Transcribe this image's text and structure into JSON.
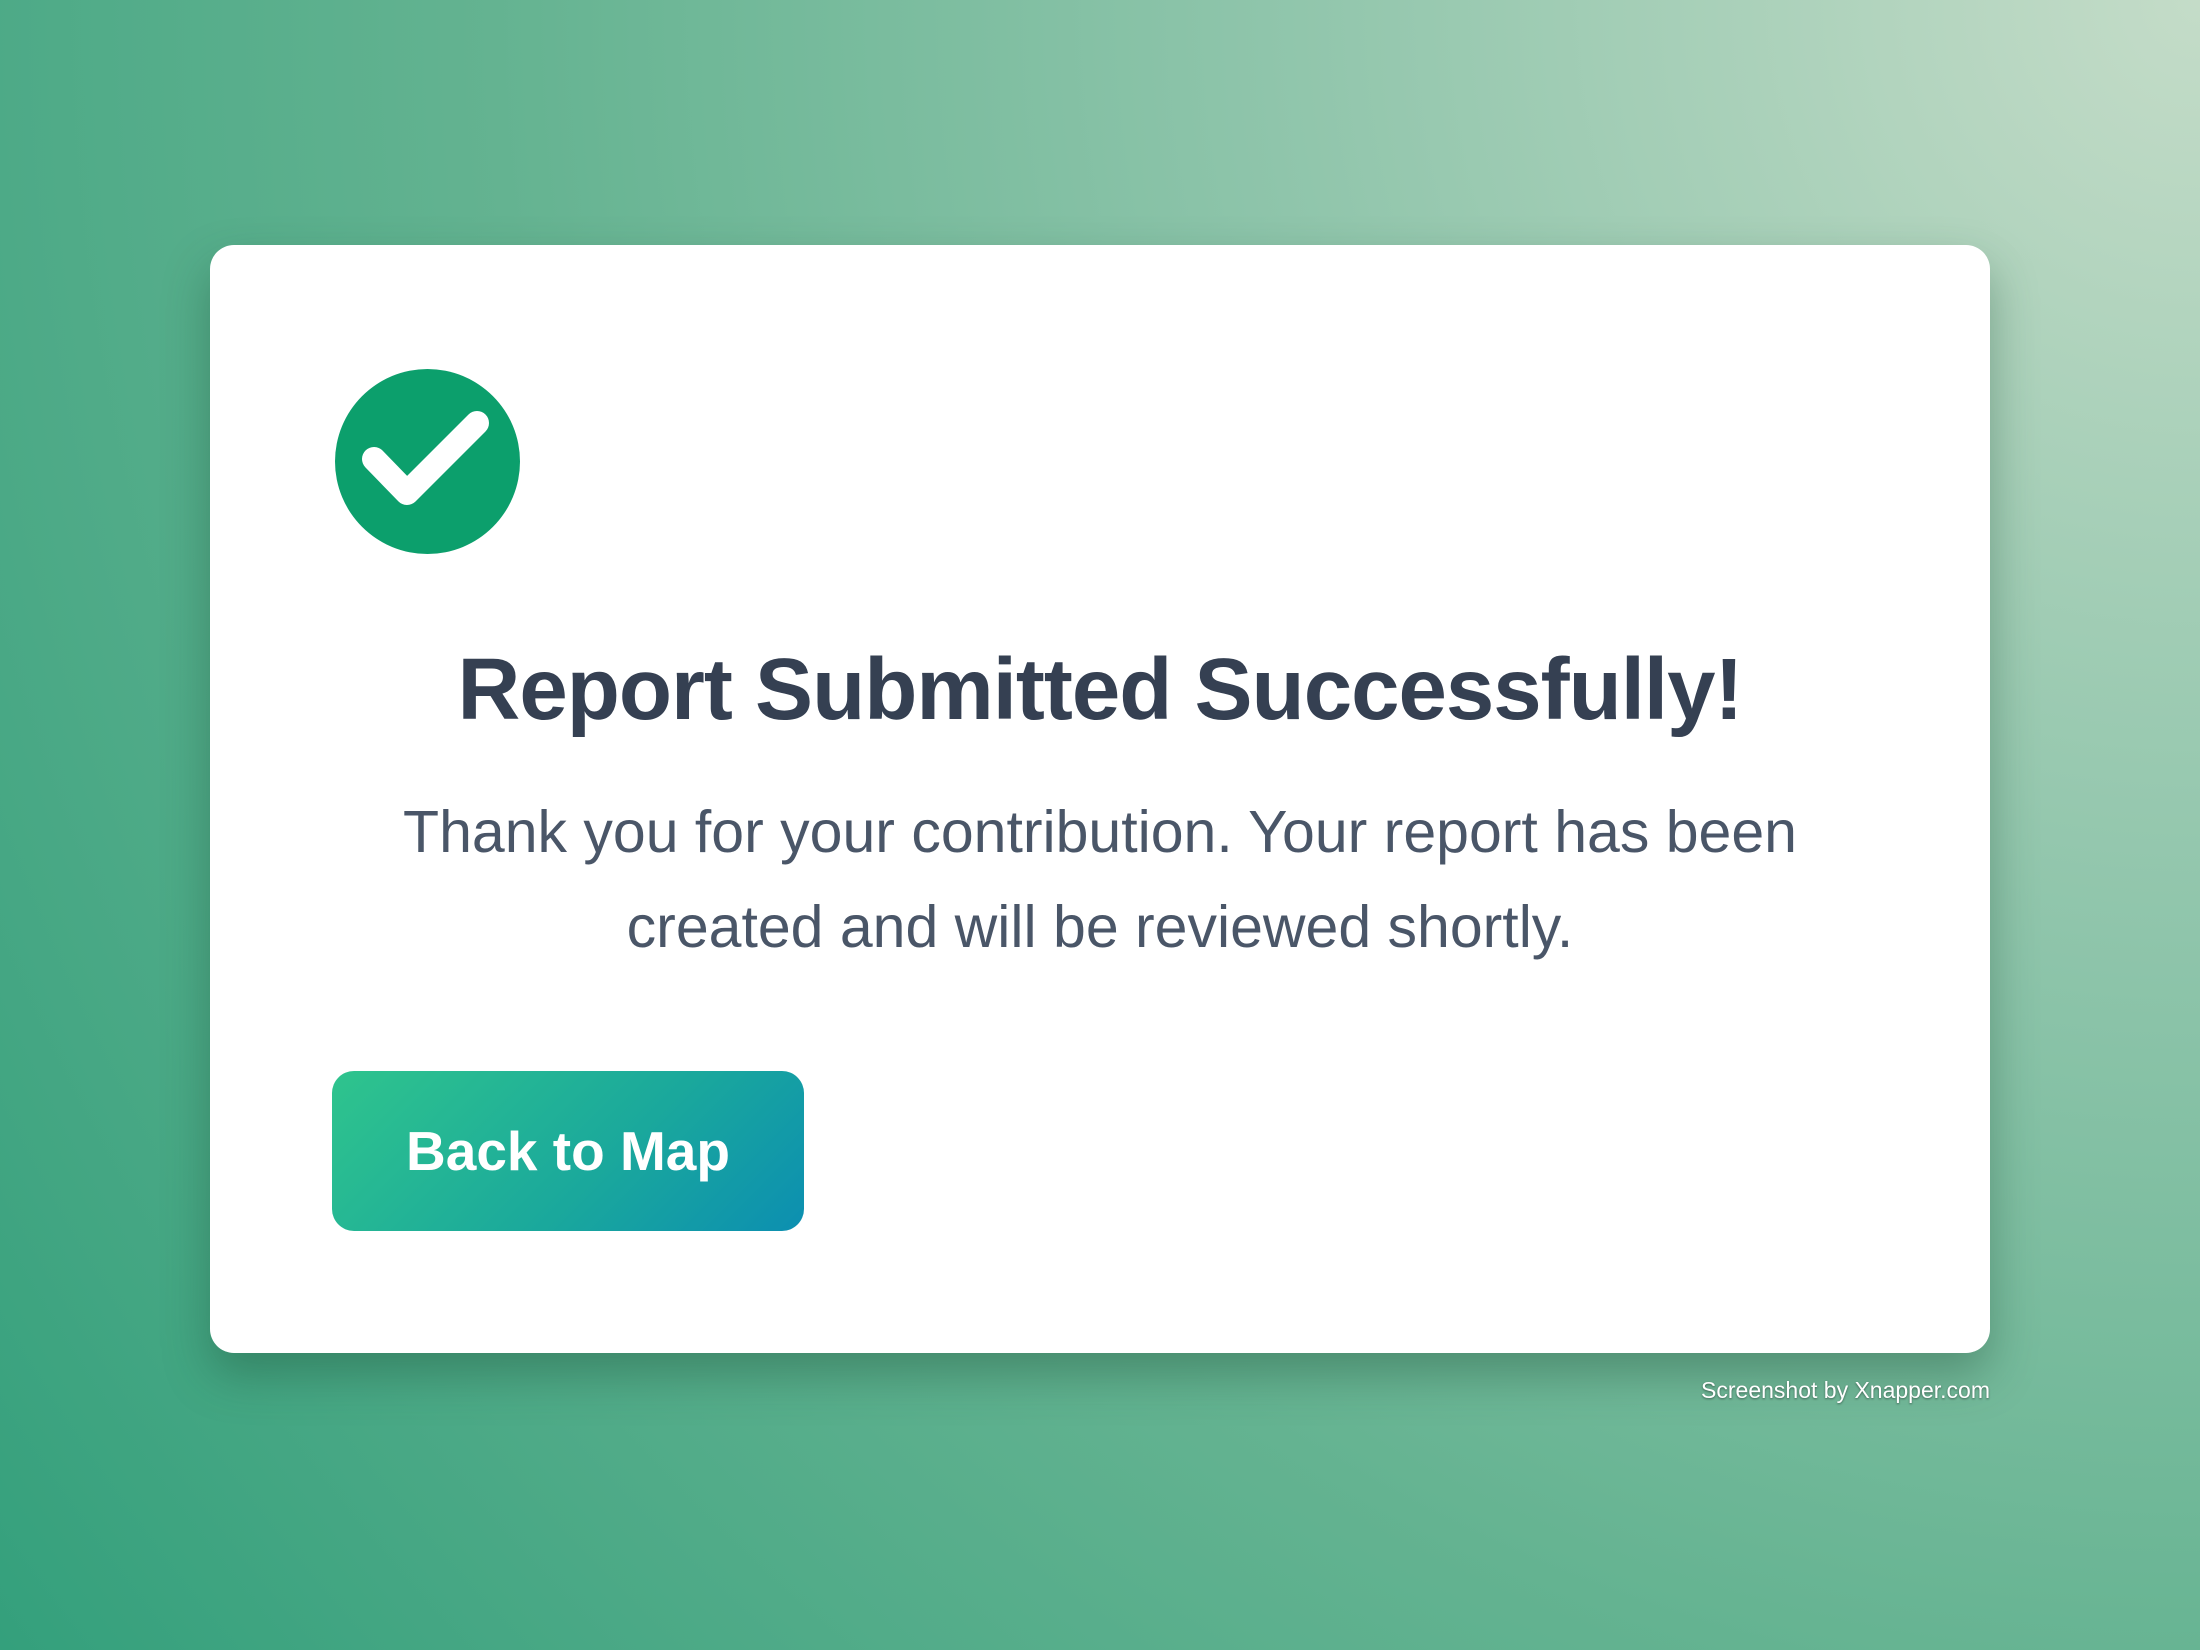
{
  "dialog": {
    "title": "Report Submitted Successfully!",
    "message": "Thank you for your contribution. Your report has been created and will be reviewed shortly.",
    "primary_button": "Back to Map",
    "icon": "check-circle-icon",
    "accent_color": "#0c9f6c"
  },
  "watermark": {
    "text": "Screenshot by Xnapper.com"
  }
}
